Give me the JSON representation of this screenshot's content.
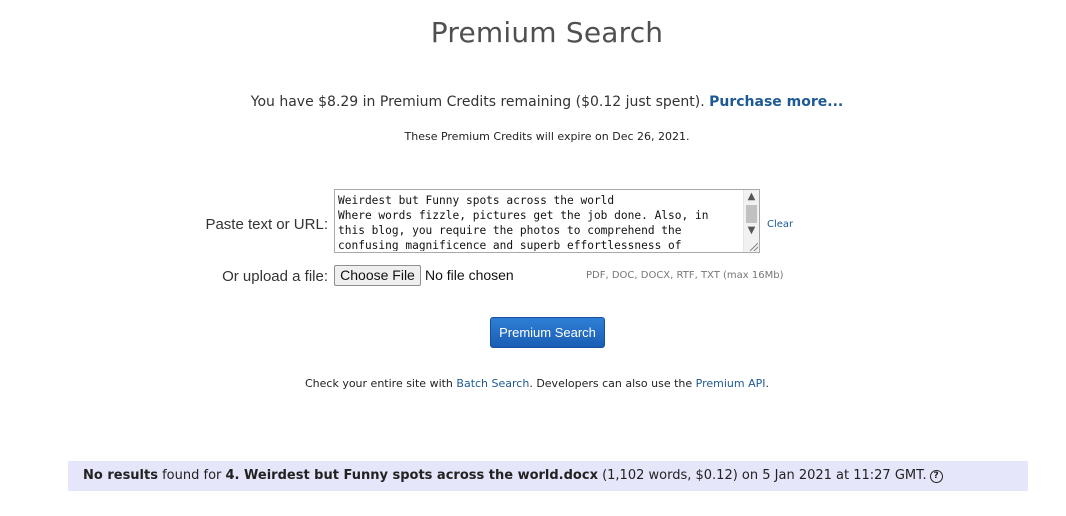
{
  "page": {
    "title": "Premium Search"
  },
  "credits": {
    "text": "You have $8.29 in Premium Credits remaining ($0.12 just spent).",
    "purchase_link": "Purchase more...",
    "expiry": "These Premium Credits will expire on Dec 26, 2021."
  },
  "form": {
    "paste_label": "Paste text or URL:",
    "textarea_value": "Weirdest but Funny spots across the world\nWhere words fizzle, pictures get the job done. Also, in\nthis blog, you require the photos to comprehend the\nconfusing magnificence and superb effortlessness of",
    "clear_label": "Clear",
    "upload_label": "Or upload a file:",
    "choose_file_label": "Choose File",
    "no_file_text": "No file chosen",
    "file_types": "PDF, DOC, DOCX, RTF, TXT (max 16Mb)",
    "submit_label": "Premium Search"
  },
  "footer_note": {
    "prefix": "Check your entire site with ",
    "batch_link": "Batch Search",
    "middle": ". Developers can also use the ",
    "api_link": "Premium API",
    "suffix": "."
  },
  "result": {
    "no_results": "No results",
    "found_for": " found for ",
    "filename": "4. Weirdest but Funny spots across the world.docx",
    "details": " (1,102 words, $0.12) on 5 Jan 2021 at 11:27 GMT.",
    "help_icon": "question-circle-icon"
  },
  "colors": {
    "link": "#1d5a95",
    "button": "#1a5db4",
    "result_background": "#e6e6fb"
  }
}
